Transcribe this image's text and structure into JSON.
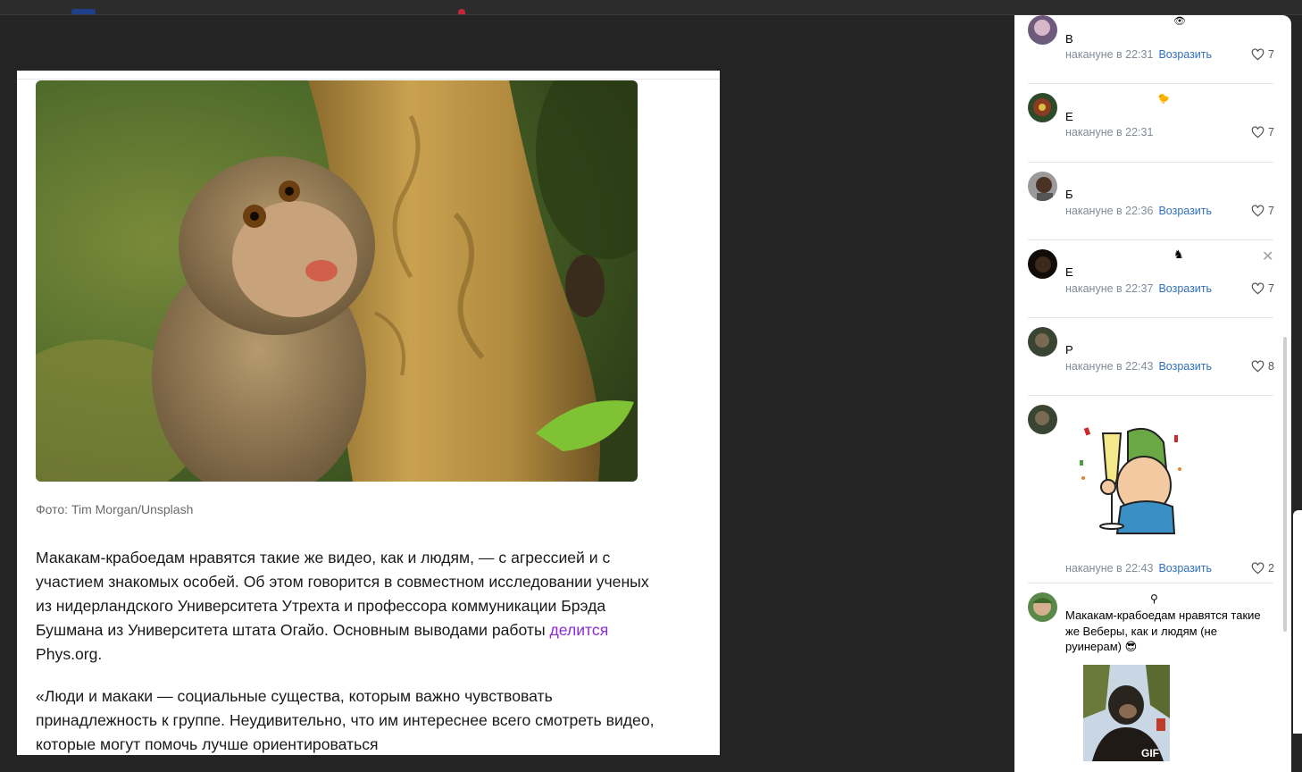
{
  "article": {
    "caption": "Фото: Tim Morgan/Unsplash",
    "p1_text": "Макакам-крабоедам нравятся такие же видео, как и людям, — с агрессией и с участием знакомых особей. Об этом говорится в совместном исследовании ученых из нидерландского Университета Утрехта и профессора коммуникации Брэда Бушмана из Университета штата Огайо. Основным выводами работы ",
    "p1_link": "делится",
    "p1_tail": " Phys.org.",
    "p2_text": "«Люди и макаки — социальные существа, которым важно чувствовать принадлежность к группе. Неудивительно, что им интереснее всего смотреть видео, которые могут помочь лучше ориентироваться"
  },
  "comments": [
    {
      "author": "В",
      "time": "накануне в 22:31",
      "reply": "Возразить",
      "likes": "7"
    },
    {
      "author": "Е",
      "time": "накануне в 22:31",
      "reply": "",
      "likes": "7"
    },
    {
      "author": "Б",
      "time": "накануне в 22:36",
      "reply": "Возразить",
      "likes": "7"
    },
    {
      "author": "Е",
      "time": "накануне в 22:37",
      "reply": "Возразить",
      "likes": "7"
    },
    {
      "author": "Р",
      "time": "накануне в 22:43",
      "reply": "Возразить",
      "likes": "8"
    },
    {
      "author": "",
      "time": "накануне в 22:43",
      "reply": "Возразить",
      "likes": "2"
    },
    {
      "author": "",
      "text": "Макакам-крабоедам нравятся такие же Веберы, как и людям (не руинерам) 😎",
      "gif_label": "GIF"
    }
  ],
  "icons": {
    "like": "heart-outline-icon",
    "close": "close-icon"
  },
  "colors": {
    "link": "#8a2bd6",
    "reply": "#2f6fbf",
    "meta": "#818c99",
    "background": "#242424"
  }
}
